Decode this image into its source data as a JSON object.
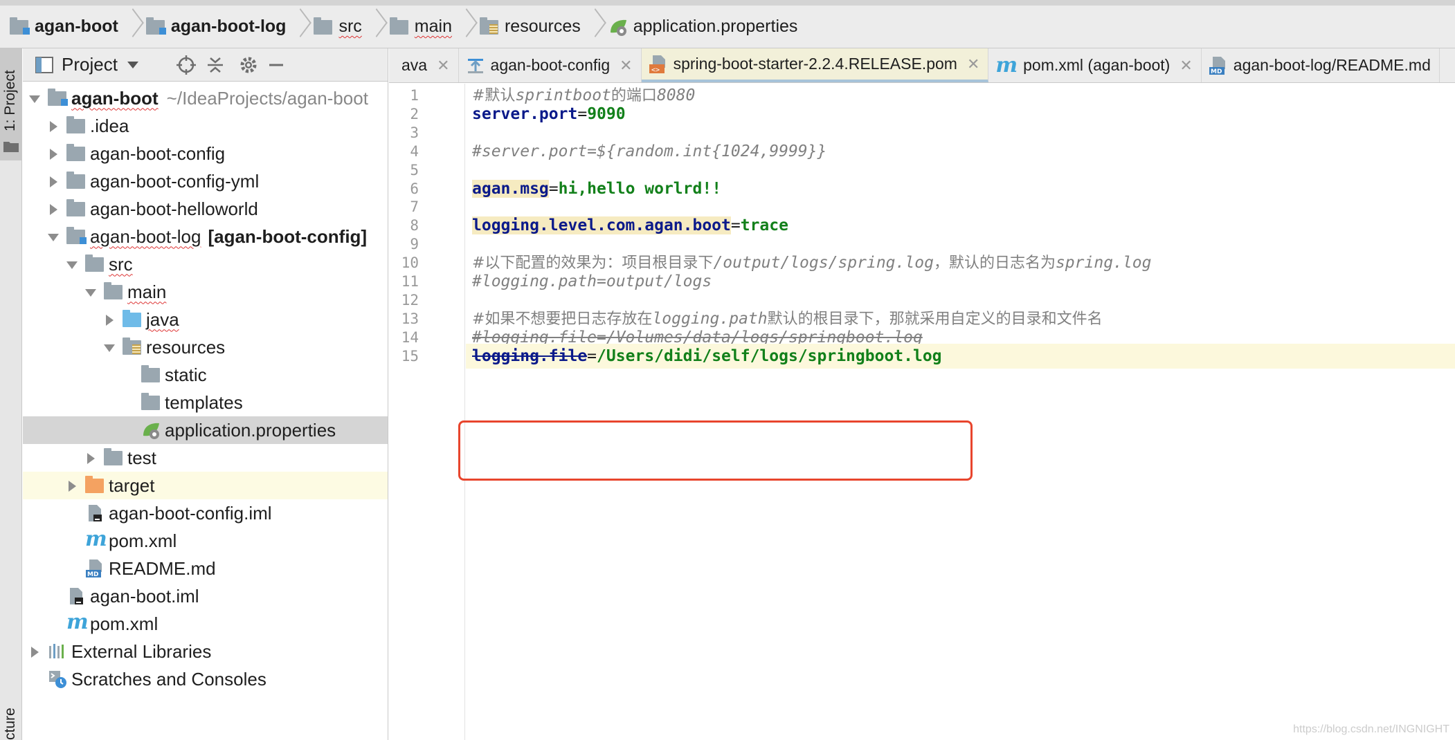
{
  "breadcrumb": [
    {
      "label": "agan-boot",
      "icon": "module-folder-icon",
      "bold": true
    },
    {
      "label": "agan-boot-log",
      "icon": "module-folder-icon",
      "bold": true
    },
    {
      "label": "src",
      "icon": "folder-icon"
    },
    {
      "label": "main",
      "icon": "folder-icon"
    },
    {
      "label": "resources",
      "icon": "resources-folder-icon"
    },
    {
      "label": "application.properties",
      "icon": "spring-properties-icon"
    }
  ],
  "tool_strip": {
    "project_tab": "1: Project",
    "structure_tab": "cture"
  },
  "project_panel": {
    "title": "Project",
    "tree": [
      {
        "depth": 0,
        "arrow": "down",
        "icon": "module",
        "label": "agan-boot",
        "bold": true,
        "path": "~/IdeaProjects/agan-boot"
      },
      {
        "depth": 1,
        "arrow": "right",
        "icon": "folder",
        "label": ".idea"
      },
      {
        "depth": 1,
        "arrow": "right",
        "icon": "folder",
        "label": "agan-boot-config"
      },
      {
        "depth": 1,
        "arrow": "right",
        "icon": "folder",
        "label": "agan-boot-config-yml"
      },
      {
        "depth": 1,
        "arrow": "right",
        "icon": "folder",
        "label": "agan-boot-helloworld"
      },
      {
        "depth": 1,
        "arrow": "down",
        "icon": "module",
        "label": "agan-boot-log",
        "extra": "[agan-boot-config]"
      },
      {
        "depth": 2,
        "arrow": "down",
        "icon": "folder",
        "label": "src"
      },
      {
        "depth": 3,
        "arrow": "down",
        "icon": "folder",
        "label": "main"
      },
      {
        "depth": 4,
        "arrow": "right",
        "icon": "folder-blue",
        "label": "java"
      },
      {
        "depth": 4,
        "arrow": "down",
        "icon": "folder-res",
        "label": "resources"
      },
      {
        "depth": 5,
        "arrow": "",
        "icon": "folder",
        "label": "static"
      },
      {
        "depth": 5,
        "arrow": "",
        "icon": "folder",
        "label": "templates"
      },
      {
        "depth": 5,
        "arrow": "",
        "icon": "spring",
        "label": "application.properties",
        "selected": true
      },
      {
        "depth": 3,
        "arrow": "right",
        "icon": "folder",
        "label": "test"
      },
      {
        "depth": 2,
        "arrow": "right",
        "icon": "folder-orange",
        "label": "target",
        "excluded": true
      },
      {
        "depth": 2,
        "arrow": "",
        "icon": "iml",
        "label": "agan-boot-config.iml"
      },
      {
        "depth": 2,
        "arrow": "",
        "icon": "maven",
        "label": "pom.xml"
      },
      {
        "depth": 2,
        "arrow": "",
        "icon": "md",
        "label": "README.md"
      },
      {
        "depth": 1,
        "arrow": "",
        "icon": "iml",
        "label": "agan-boot.iml"
      },
      {
        "depth": 1,
        "arrow": "",
        "icon": "maven",
        "label": "pom.xml"
      },
      {
        "depth": 0,
        "arrow": "right",
        "icon": "libraries",
        "label": "External Libraries"
      },
      {
        "depth": 0,
        "arrow": "",
        "icon": "scratches",
        "label": "Scratches and Consoles"
      }
    ]
  },
  "editor_tabs": [
    {
      "label": "ava",
      "icon": "",
      "closable": true
    },
    {
      "label": "agan-boot-config",
      "icon": "config-icon",
      "closable": true
    },
    {
      "label": "spring-boot-starter-2.2.4.RELEASE.pom",
      "icon": "pom-icon",
      "closable": true,
      "active": true
    },
    {
      "label": "pom.xml (agan-boot)",
      "icon": "maven-icon",
      "closable": true
    },
    {
      "label": "agan-boot-log/README.md",
      "icon": "md-icon",
      "closable": false
    }
  ],
  "editor": {
    "lines": [
      {
        "no": "1",
        "segments": [
          {
            "t": "#默认",
            "c": "cmt-cn"
          },
          {
            "t": "sprintboot",
            "c": "cmt"
          },
          {
            "t": "的端口",
            "c": "cmt-cn"
          },
          {
            "t": "8080",
            "c": "cmt"
          }
        ]
      },
      {
        "no": "2",
        "segments": [
          {
            "t": "server.port",
            "c": "key"
          },
          {
            "t": "=",
            "c": "eq"
          },
          {
            "t": "9090",
            "c": "val"
          }
        ]
      },
      {
        "no": "3",
        "segments": []
      },
      {
        "no": "4",
        "segments": [
          {
            "t": "#server.port=${random.int{1024,9999}}",
            "c": "cmt"
          }
        ]
      },
      {
        "no": "5",
        "segments": []
      },
      {
        "no": "6",
        "segments": [
          {
            "t": "agan.msg",
            "c": "key hl"
          },
          {
            "t": "=",
            "c": "eq"
          },
          {
            "t": "hi,hello worlrd!!",
            "c": "val"
          }
        ]
      },
      {
        "no": "7",
        "segments": []
      },
      {
        "no": "8",
        "segments": [
          {
            "t": "logging.level.com.agan.boot",
            "c": "key hl"
          },
          {
            "t": "=",
            "c": "eq"
          },
          {
            "t": "trace",
            "c": "val"
          }
        ]
      },
      {
        "no": "9",
        "segments": []
      },
      {
        "no": "10",
        "segments": [
          {
            "t": "#以下配置的效果为：项目根目录下",
            "c": "cmt-cn"
          },
          {
            "t": "/output/logs/spring.log",
            "c": "cmt"
          },
          {
            "t": "，默认的日志名为",
            "c": "cmt-cn"
          },
          {
            "t": "spring.log",
            "c": "cmt"
          }
        ]
      },
      {
        "no": "11",
        "segments": [
          {
            "t": "#logging.path=output/logs",
            "c": "cmt"
          }
        ]
      },
      {
        "no": "12",
        "segments": []
      },
      {
        "no": "13",
        "segments": [
          {
            "t": "#如果不想要把日志存放在",
            "c": "cmt-cn"
          },
          {
            "t": "logging.path",
            "c": "cmt"
          },
          {
            "t": "默认的根目录下，那就采用自定义的目录和文件名",
            "c": "cmt-cn"
          }
        ]
      },
      {
        "no": "14",
        "segments": [
          {
            "t": "#logging.file=/Volumes/data/logs/springboot.log",
            "c": "cmt strike-cmt"
          }
        ]
      },
      {
        "no": "15",
        "current": true,
        "segments": [
          {
            "t": "logging.file",
            "c": "key strike"
          },
          {
            "t": "=",
            "c": "eq"
          },
          {
            "t": "/Users/didi/self/logs/springboot.log",
            "c": "val"
          }
        ]
      }
    ]
  },
  "watermark": "https://blog.csdn.net/INGNIGHT",
  "colors": {
    "key": "#0b1a8a",
    "value": "#12801a",
    "comment": "#808080",
    "highlight_box": "#e8452d",
    "selection": "#d5d5d5"
  }
}
